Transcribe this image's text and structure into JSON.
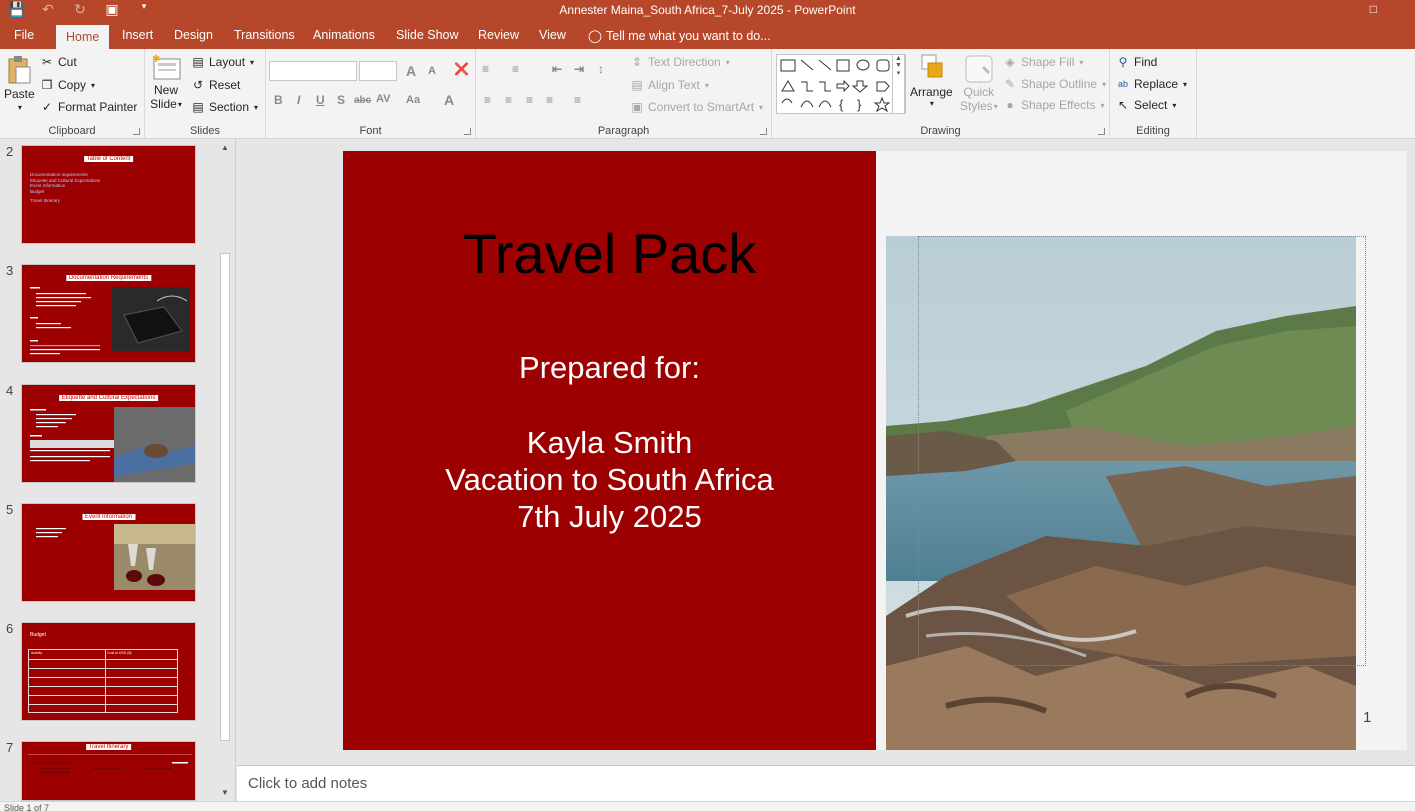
{
  "window": {
    "title": "Annester Maina_South Africa_7-July 2025 - PowerPoint"
  },
  "tabs": [
    {
      "label": "File"
    },
    {
      "label": "Home"
    },
    {
      "label": "Insert"
    },
    {
      "label": "Design"
    },
    {
      "label": "Transitions"
    },
    {
      "label": "Animations"
    },
    {
      "label": "Slide Show"
    },
    {
      "label": "Review"
    },
    {
      "label": "View"
    }
  ],
  "tell_me": "Tell me what you want to do...",
  "clipboard": {
    "paste": "Paste",
    "cut": "Cut",
    "copy": "Copy",
    "format_painter": "Format Painter",
    "label": "Clipboard"
  },
  "slides_group": {
    "new_slide_line1": "New",
    "new_slide_line2": "Slide",
    "layout": "Layout",
    "reset": "Reset",
    "section": "Section",
    "label": "Slides"
  },
  "font_group": {
    "label": "Font",
    "bold": "B",
    "italic": "I",
    "underline": "U",
    "shadow": "S",
    "strike": "abc",
    "spacing": "AV",
    "case": "Aa",
    "color": "A",
    "grow": "A",
    "shrink": "A"
  },
  "paragraph_group": {
    "label": "Paragraph",
    "text_direction": "Text Direction",
    "align_text": "Align Text",
    "convert_smartart": "Convert to SmartArt"
  },
  "drawing_group": {
    "label": "Drawing",
    "arrange": "Arrange",
    "quick_styles_line1": "Quick",
    "quick_styles_line2": "Styles",
    "shape_fill": "Shape Fill",
    "shape_outline": "Shape Outline",
    "shape_effects": "Shape Effects"
  },
  "editing_group": {
    "label": "Editing",
    "find": "Find",
    "replace": "Replace",
    "select": "Select"
  },
  "thumbnails": [
    {
      "num": "2",
      "title": "Table of Content",
      "lines": [
        "Documentation requirements",
        "Etiquette and Cultural Expectations",
        "Event Information",
        "Budget",
        "",
        "Travel Itinerary"
      ]
    },
    {
      "num": "3",
      "title": "Documentation Requirements"
    },
    {
      "num": "4",
      "title": "Etiquette and Cultural Expectations"
    },
    {
      "num": "5",
      "title": "Event Information"
    },
    {
      "num": "6",
      "title": "Budget",
      "col1": "Activity",
      "col2": "Cost in USD ($)"
    },
    {
      "num": "7",
      "title": "Travel Itinerary"
    }
  ],
  "slide": {
    "title": "Travel Pack",
    "prepared_for": "Prepared for:",
    "name": "Kayla Smith",
    "trip": "Vacation to South Africa",
    "date": "7th July 2025",
    "slide_number": "1"
  },
  "notes_placeholder": "Click to add notes",
  "status": {
    "slide_of": "Slide 1 of 7"
  },
  "colors": {
    "accent": "#b7472a",
    "slide_red": "#9c0000"
  }
}
